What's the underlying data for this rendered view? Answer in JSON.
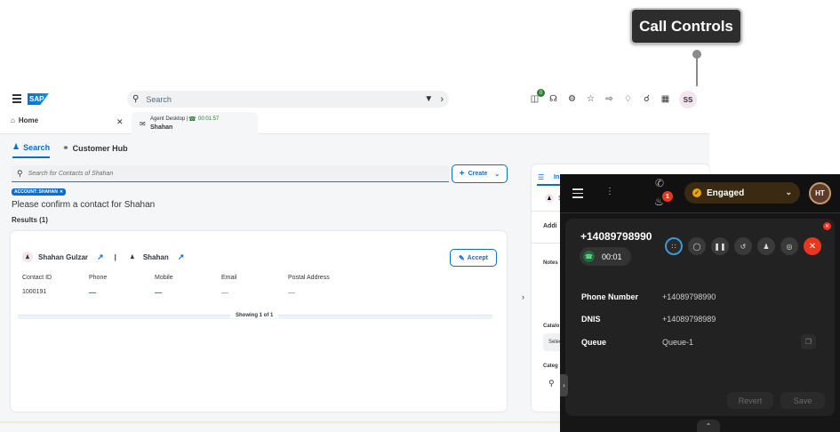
{
  "callout": {
    "label": "Call Controls"
  },
  "shell": {
    "logo": "SAP",
    "search_placeholder": "Search",
    "icons": [
      "hamburger-icon",
      "filter-icon",
      "chevron-right-icon",
      "connector-icon",
      "headset-icon",
      "settings-icon",
      "star-icon",
      "export-icon",
      "tag-icon",
      "bell-icon",
      "grid-icon"
    ],
    "connector_badge": "0",
    "avatar": "SS"
  },
  "tabs": {
    "home": "Home",
    "agent_title": "Agent Desktop |",
    "agent_time": "00:01:57",
    "agent_name": "Shahan"
  },
  "subtabs": {
    "search": "Search",
    "customer_hub": "Customer Hub"
  },
  "search": {
    "placeholder": "Search for Contacts of Shahan",
    "create": "Create",
    "chip": "ACCOUNT: SHAHAN",
    "confirm": "Please confirm a contact for Shahan",
    "results": "Results (1)"
  },
  "card": {
    "contact_name": "Shahan Gulzar",
    "separator": "|",
    "account_name": "Shahan",
    "accept": "Accept",
    "columns": [
      "Contact ID",
      "Phone",
      "Mobile",
      "Email",
      "Postal Address"
    ],
    "row": {
      "contact_id": "1000191",
      "phone": "—",
      "mobile": "—",
      "email": "—",
      "postal": "—"
    },
    "showing": "Showing 1 of 1"
  },
  "right_panel": {
    "tab": "In",
    "item_s": "S",
    "addi": "Addi",
    "notes": "Notes",
    "catalog": "Catalo",
    "select": "Selec",
    "categ": "Categ"
  },
  "call": {
    "notifications": "1",
    "status": "Engaged",
    "avatar": "HT",
    "number": "+14089798990",
    "timer": "00:01",
    "fields": [
      {
        "label": "Phone Number",
        "value": "+14089798990"
      },
      {
        "label": "DNIS",
        "value": "+14089798989"
      },
      {
        "label": "Queue",
        "value": "Queue-1"
      }
    ],
    "revert": "Revert",
    "save": "Save",
    "colors": {
      "engaged": "#e8a317",
      "end_call": "#e9361f",
      "selected_ring": "#3a9ad9"
    }
  }
}
